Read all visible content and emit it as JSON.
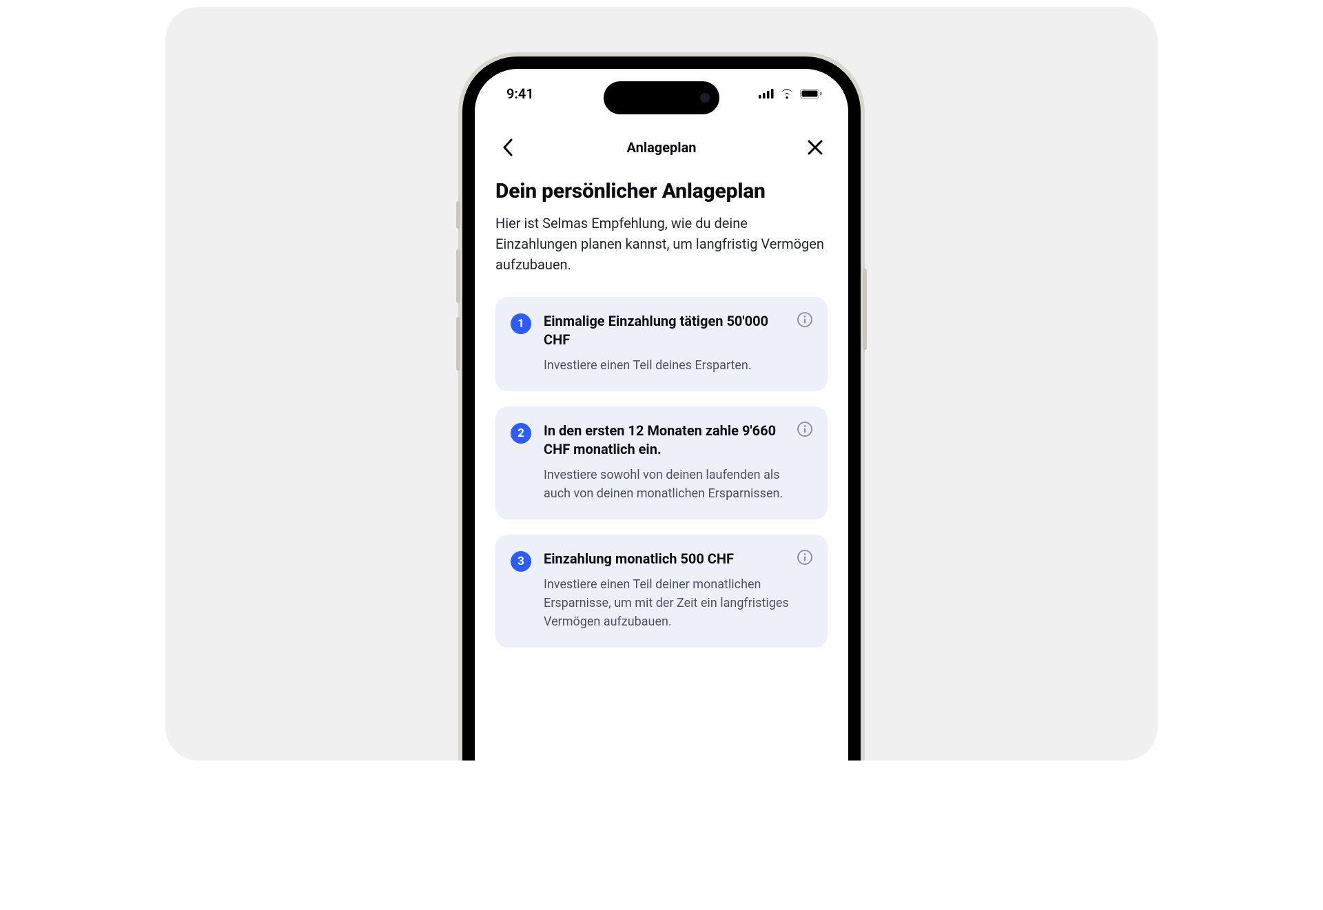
{
  "statusbar": {
    "time": "9:41"
  },
  "nav": {
    "title": "Anlageplan"
  },
  "page": {
    "heading": "Dein persönlicher Anlageplan",
    "subheading": "Hier ist Selmas Empfehlung, wie du deine Einzahlungen planen kannst, um langfristig Vermögen aufzubauen."
  },
  "steps": [
    {
      "num": "1",
      "title": "Einmalige Einzahlung tätigen 50'000 CHF",
      "desc": "Investiere einen Teil deines Ersparten."
    },
    {
      "num": "2",
      "title": "In den ersten 12 Monaten zahle 9'660 CHF monatlich ein.",
      "desc": "Investiere sowohl von deinen laufenden als auch von deinen monatlichen Ersparnissen."
    },
    {
      "num": "3",
      "title": "Einzahlung monatlich 500 CHF",
      "desc": "Investiere einen Teil deiner monatlichen Ersparnisse, um mit der Zeit ein langfristiges Vermögen aufzubauen."
    }
  ],
  "colors": {
    "accent": "#2c5bff",
    "card_bg": "#eef0f9",
    "stage_bg": "#f0f0f0"
  }
}
